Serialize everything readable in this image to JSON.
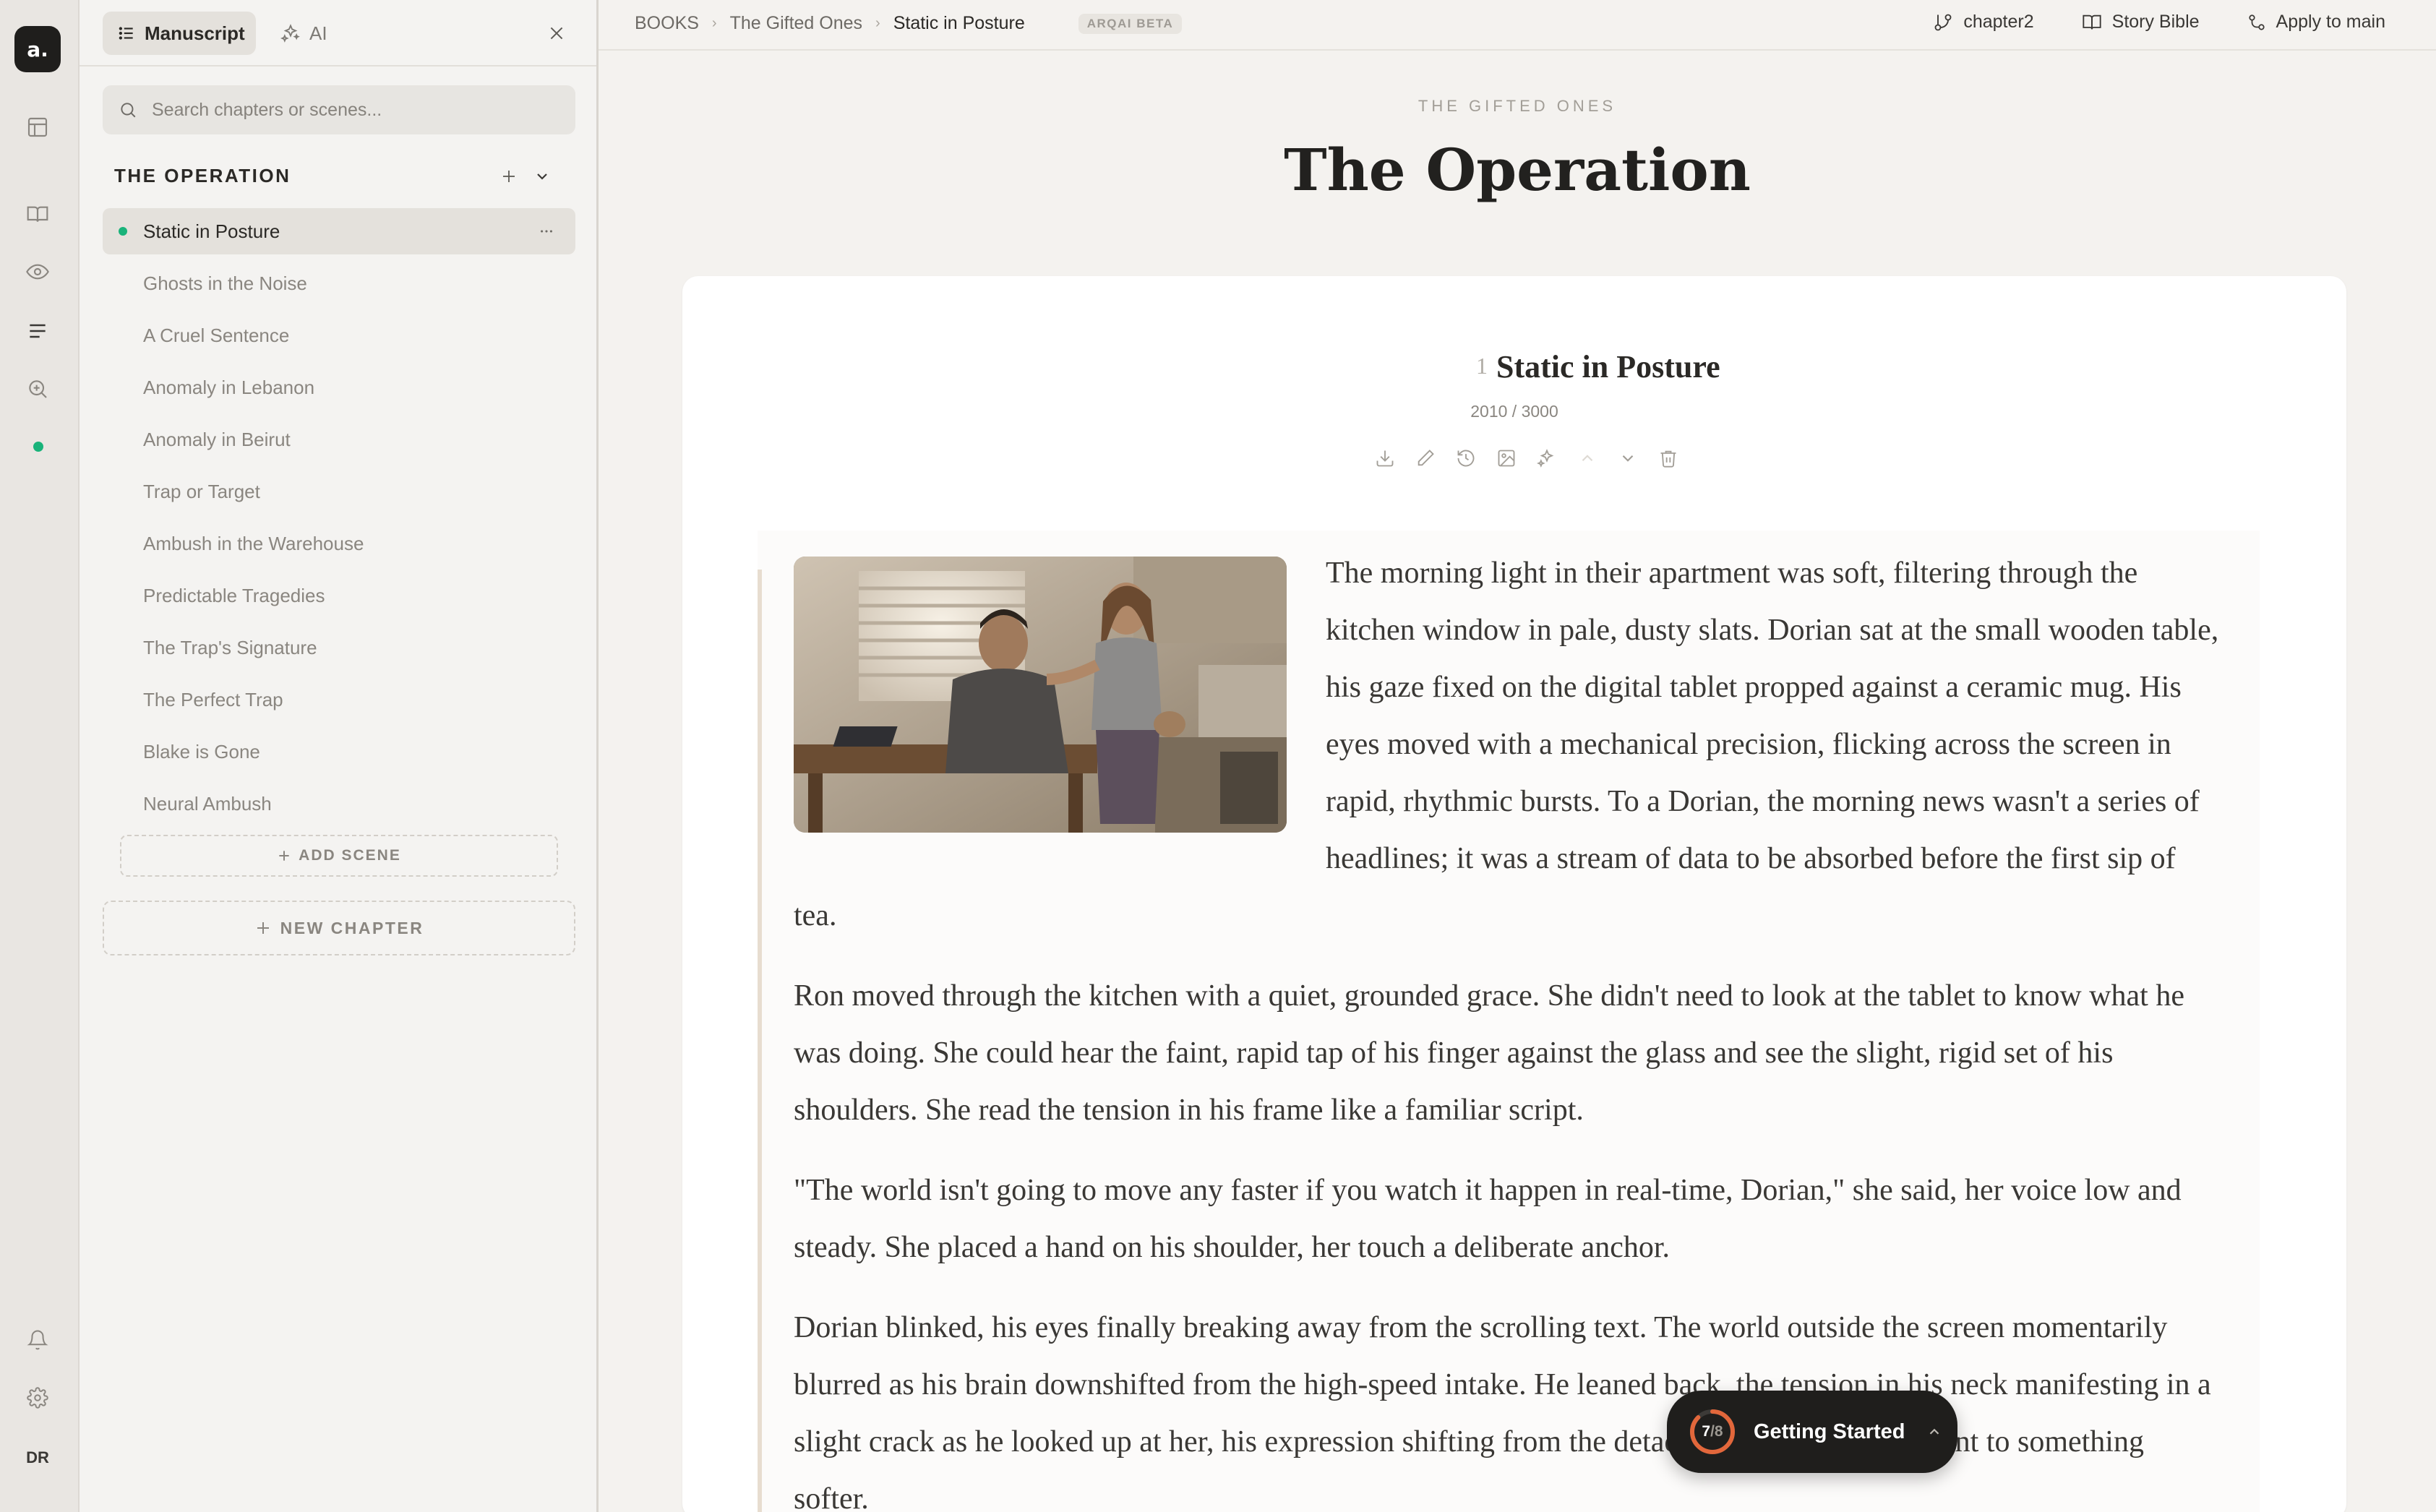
{
  "app": {
    "logo": "a.",
    "user_initials": "DR"
  },
  "rail": {
    "icons": [
      "layout-icon",
      "book-icon",
      "eye-icon",
      "manuscript-lines-icon",
      "zoom-search-icon",
      "status-dot",
      "bell-icon",
      "gear-icon"
    ]
  },
  "sidebar": {
    "tabs": {
      "manuscript": "Manuscript",
      "ai": "AI"
    },
    "search": {
      "placeholder": "Search chapters or scenes..."
    },
    "chapter": {
      "title": "THE OPERATION"
    },
    "scenes": [
      "Static in Posture",
      "Ghosts in the Noise",
      "A Cruel Sentence",
      "Anomaly in Lebanon",
      "Anomaly in Beirut",
      "Trap or Target",
      "Ambush in the Warehouse",
      "Predictable Tragedies",
      "The Trap's Signature",
      "The Perfect Trap",
      "Blake is Gone",
      "Neural Ambush"
    ],
    "active_scene_index": 0,
    "add_scene": "ADD SCENE",
    "new_chapter": "NEW CHAPTER"
  },
  "topbar": {
    "breadcrumb": [
      "BOOKS",
      "The Gifted Ones",
      "Static in Posture"
    ],
    "beta": "ARQAI BETA",
    "branch": "chapter2",
    "story_bible": "Story Bible",
    "apply": "Apply to main"
  },
  "book": {
    "kicker": "THE GIFTED ONES",
    "chapter_title": "The Operation"
  },
  "scene": {
    "number": "1",
    "title": "Static in Posture",
    "word_count": "2010 / 3000",
    "paragraphs": [
      "The morning light in their apartment was soft, filtering through the kitchen window in pale, dusty slats. Dorian sat at the small wooden table, his gaze fixed on the digital tablet propped against a ceramic mug. His eyes moved with a mechanical precision, flicking across the screen in rapid, rhythmic bursts. To a Dorian, the morning news wasn't a series of headlines; it was a stream of data to be absorbed before the first sip of tea.",
      "Ron moved through the kitchen with a quiet, grounded grace. She didn't need to look at the tablet to know what he was doing. She could hear the faint, rapid tap of his finger against the glass and see the slight, rigid set of his shoulders. She read the tension in his frame like a familiar script.",
      "\"The world isn't going to move any faster if you watch it happen in real-time, Dorian,\" she said, her voice low and steady. She placed a hand on his shoulder, her touch a deliberate anchor.",
      "Dorian blinked, his eyes finally breaking away from the scrolling text. The world outside the screen momentarily blurred as his brain downshifted from the high-speed intake. He leaned back, the tension in his neck manifesting in a slight crack as he looked up at her, his expression shifting from the detached mask of a lead agent to something softer."
    ]
  },
  "onboarding": {
    "done": "7",
    "total": "/8",
    "progress": 0.875,
    "label": "Getting Started"
  },
  "colors": {
    "accent_green": "#19b37a",
    "ring_orange": "#e2673b",
    "dark": "#1f1e1c"
  }
}
